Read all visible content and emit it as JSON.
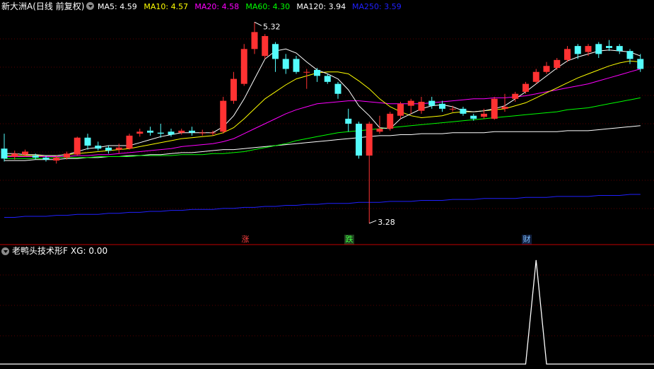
{
  "header": {
    "title": "新大洲A(日线 前复权)",
    "ma": [
      {
        "label": "MA5:",
        "value": "4.59",
        "color": "#ffffff"
      },
      {
        "label": "MA10:",
        "value": "4.57",
        "color": "#ffff00"
      },
      {
        "label": "MA20:",
        "value": "4.58",
        "color": "#ff00ff"
      },
      {
        "label": "MA60:",
        "value": "4.30",
        "color": "#00ff00"
      },
      {
        "label": "MA120:",
        "value": "3.94",
        "color": "#ffffff"
      },
      {
        "label": "MA250:",
        "value": "3.59",
        "color": "#2020ff"
      }
    ]
  },
  "markers": {
    "high": "5.32",
    "low": "3.28",
    "zhang": "涨",
    "die": "跌",
    "cai": "财"
  },
  "indicator": {
    "title": "老鸭头技术形F",
    "xg": "XG: 0.00"
  },
  "colors": {
    "up": "#ff3232",
    "down": "#54fcfc",
    "ma5": "#ffffff",
    "ma10": "#ffff00",
    "ma20": "#ff00ff",
    "ma60": "#00ff00",
    "ma120": "#ffffff",
    "ma250": "#2020ff"
  },
  "chart_data": {
    "type": "candlestick",
    "ylim": [
      3.2,
      5.4
    ],
    "candles": [
      {
        "o": 4.05,
        "c": 3.95,
        "h": 4.2,
        "l": 3.92
      },
      {
        "o": 3.97,
        "c": 4.0,
        "h": 4.03,
        "l": 3.94
      },
      {
        "o": 3.99,
        "c": 4.02,
        "h": 4.04,
        "l": 3.97
      },
      {
        "o": 3.98,
        "c": 3.96,
        "h": 4.0,
        "l": 3.94
      },
      {
        "o": 3.96,
        "c": 3.94,
        "h": 3.98,
        "l": 3.92
      },
      {
        "o": 3.93,
        "c": 3.96,
        "h": 3.98,
        "l": 3.9
      },
      {
        "o": 3.96,
        "c": 4.0,
        "h": 4.02,
        "l": 3.94
      },
      {
        "o": 3.99,
        "c": 4.16,
        "h": 4.17,
        "l": 3.98
      },
      {
        "o": 4.16,
        "c": 4.08,
        "h": 4.2,
        "l": 4.04
      },
      {
        "o": 4.08,
        "c": 4.05,
        "h": 4.12,
        "l": 4.03
      },
      {
        "o": 4.06,
        "c": 4.03,
        "h": 4.08,
        "l": 4.0
      },
      {
        "o": 4.04,
        "c": 4.06,
        "h": 4.1,
        "l": 4.0
      },
      {
        "o": 4.05,
        "c": 4.18,
        "h": 4.2,
        "l": 4.04
      },
      {
        "o": 4.2,
        "c": 4.22,
        "h": 4.25,
        "l": 4.17
      },
      {
        "o": 4.23,
        "c": 4.21,
        "h": 4.27,
        "l": 4.18
      },
      {
        "o": 4.21,
        "c": 4.2,
        "h": 4.3,
        "l": 4.16
      },
      {
        "o": 4.22,
        "c": 4.19,
        "h": 4.25,
        "l": 4.17
      },
      {
        "o": 4.21,
        "c": 4.23,
        "h": 4.25,
        "l": 4.19
      },
      {
        "o": 4.23,
        "c": 4.21,
        "h": 4.27,
        "l": 4.18
      },
      {
        "o": 4.21,
        "c": 4.21,
        "h": 4.24,
        "l": 4.18
      },
      {
        "o": 4.21,
        "c": 4.21,
        "h": 4.23,
        "l": 4.18
      },
      {
        "o": 4.22,
        "c": 4.53,
        "h": 4.57,
        "l": 4.2
      },
      {
        "o": 4.53,
        "c": 4.75,
        "h": 4.82,
        "l": 4.5
      },
      {
        "o": 4.7,
        "c": 5.05,
        "h": 5.1,
        "l": 4.68
      },
      {
        "o": 5.05,
        "c": 5.22,
        "h": 5.32,
        "l": 5.0
      },
      {
        "o": 4.98,
        "c": 5.18,
        "h": 5.2,
        "l": 4.95
      },
      {
        "o": 5.1,
        "c": 4.95,
        "h": 5.12,
        "l": 4.82
      },
      {
        "o": 4.95,
        "c": 4.85,
        "h": 5.0,
        "l": 4.8
      },
      {
        "o": 4.95,
        "c": 4.82,
        "h": 4.98,
        "l": 4.8
      },
      {
        "o": 4.82,
        "c": 4.82,
        "h": 4.85,
        "l": 4.65
      },
      {
        "o": 4.84,
        "c": 4.78,
        "h": 4.86,
        "l": 4.72
      },
      {
        "o": 4.78,
        "c": 4.72,
        "h": 4.8,
        "l": 4.7
      },
      {
        "o": 4.7,
        "c": 4.6,
        "h": 4.72,
        "l": 4.55
      },
      {
        "o": 4.35,
        "c": 4.3,
        "h": 4.45,
        "l": 4.22
      },
      {
        "o": 4.3,
        "c": 3.98,
        "h": 4.32,
        "l": 3.95
      },
      {
        "o": 3.98,
        "c": 4.3,
        "h": 4.32,
        "l": 3.3
      },
      {
        "o": 4.22,
        "c": 4.25,
        "h": 4.38,
        "l": 4.2
      },
      {
        "o": 4.25,
        "c": 4.4,
        "h": 4.42,
        "l": 4.23
      },
      {
        "o": 4.38,
        "c": 4.5,
        "h": 4.52,
        "l": 4.35
      },
      {
        "o": 4.48,
        "c": 4.53,
        "h": 4.55,
        "l": 4.4
      },
      {
        "o": 4.43,
        "c": 4.52,
        "h": 4.57,
        "l": 4.4
      },
      {
        "o": 4.53,
        "c": 4.48,
        "h": 4.57,
        "l": 4.45
      },
      {
        "o": 4.5,
        "c": 4.45,
        "h": 4.53,
        "l": 4.42
      },
      {
        "o": 4.45,
        "c": 4.45,
        "h": 4.48,
        "l": 4.42
      },
      {
        "o": 4.45,
        "c": 4.4,
        "h": 4.47,
        "l": 4.38
      },
      {
        "o": 4.38,
        "c": 4.35,
        "h": 4.4,
        "l": 4.33
      },
      {
        "o": 4.37,
        "c": 4.4,
        "h": 4.45,
        "l": 4.35
      },
      {
        "o": 4.35,
        "c": 4.55,
        "h": 4.57,
        "l": 4.34
      },
      {
        "o": 4.45,
        "c": 4.47,
        "h": 4.6,
        "l": 4.42
      },
      {
        "o": 4.55,
        "c": 4.6,
        "h": 4.62,
        "l": 4.52
      },
      {
        "o": 4.62,
        "c": 4.7,
        "h": 4.72,
        "l": 4.6
      },
      {
        "o": 4.72,
        "c": 4.82,
        "h": 4.85,
        "l": 4.7
      },
      {
        "o": 4.82,
        "c": 4.88,
        "h": 4.92,
        "l": 4.8
      },
      {
        "o": 4.86,
        "c": 4.94,
        "h": 4.96,
        "l": 4.84
      },
      {
        "o": 4.94,
        "c": 5.05,
        "h": 5.08,
        "l": 4.92
      },
      {
        "o": 5.08,
        "c": 5.0,
        "h": 5.1,
        "l": 4.95
      },
      {
        "o": 5.02,
        "c": 5.08,
        "h": 5.1,
        "l": 4.98
      },
      {
        "o": 5.1,
        "c": 5.0,
        "h": 5.12,
        "l": 4.96
      },
      {
        "o": 5.08,
        "c": 5.06,
        "h": 5.14,
        "l": 5.03
      },
      {
        "o": 5.08,
        "c": 5.03,
        "h": 5.1,
        "l": 5.0
      },
      {
        "o": 5.03,
        "c": 4.95,
        "h": 5.05,
        "l": 4.9
      },
      {
        "o": 4.95,
        "c": 4.85,
        "h": 5.0,
        "l": 4.82
      }
    ],
    "ma5": [
      4.0,
      4.0,
      3.99,
      3.99,
      3.98,
      3.98,
      3.99,
      4.02,
      4.05,
      4.06,
      4.08,
      4.08,
      4.08,
      4.11,
      4.14,
      4.17,
      4.19,
      4.21,
      4.21,
      4.21,
      4.21,
      4.27,
      4.38,
      4.55,
      4.75,
      4.95,
      5.03,
      5.05,
      5.01,
      4.92,
      4.84,
      4.8,
      4.75,
      4.64,
      4.48,
      4.38,
      4.26,
      4.25,
      4.35,
      4.4,
      4.45,
      4.48,
      4.49,
      4.47,
      4.43,
      4.42,
      4.43,
      4.45,
      4.48,
      4.55,
      4.62,
      4.7,
      4.78,
      4.86,
      4.93,
      4.97,
      5.0,
      5.03,
      5.04,
      5.03,
      5.02,
      4.98
    ],
    "ma10": [
      3.98,
      3.98,
      3.98,
      3.98,
      3.98,
      3.98,
      3.99,
      4.0,
      4.01,
      4.02,
      4.03,
      4.04,
      4.05,
      4.07,
      4.09,
      4.11,
      4.13,
      4.15,
      4.16,
      4.17,
      4.18,
      4.21,
      4.26,
      4.35,
      4.45,
      4.55,
      4.62,
      4.69,
      4.75,
      4.78,
      4.81,
      4.82,
      4.82,
      4.8,
      4.73,
      4.65,
      4.55,
      4.47,
      4.42,
      4.38,
      4.36,
      4.37,
      4.38,
      4.41,
      4.42,
      4.42,
      4.43,
      4.44,
      4.45,
      4.48,
      4.51,
      4.56,
      4.61,
      4.66,
      4.71,
      4.76,
      4.8,
      4.84,
      4.88,
      4.91,
      4.93,
      4.92
    ],
    "ma20": [
      3.97,
      3.97,
      3.97,
      3.97,
      3.97,
      3.97,
      3.97,
      3.98,
      3.98,
      3.99,
      3.99,
      4.0,
      4.01,
      4.02,
      4.03,
      4.04,
      4.05,
      4.07,
      4.08,
      4.09,
      4.1,
      4.12,
      4.15,
      4.2,
      4.25,
      4.3,
      4.35,
      4.4,
      4.44,
      4.47,
      4.5,
      4.51,
      4.52,
      4.53,
      4.53,
      4.52,
      4.51,
      4.5,
      4.5,
      4.5,
      4.5,
      4.51,
      4.52,
      4.53,
      4.54,
      4.55,
      4.55,
      4.56,
      4.56,
      4.57,
      4.58,
      4.6,
      4.62,
      4.64,
      4.66,
      4.68,
      4.7,
      4.73,
      4.76,
      4.79,
      4.82,
      4.85
    ],
    "ma60": [
      3.95,
      3.95,
      3.95,
      3.95,
      3.95,
      3.96,
      3.96,
      3.96,
      3.96,
      3.97,
      3.97,
      3.97,
      3.97,
      3.98,
      3.98,
      3.98,
      3.98,
      3.99,
      3.99,
      3.99,
      4.0,
      4.0,
      4.01,
      4.02,
      4.04,
      4.06,
      4.08,
      4.1,
      4.13,
      4.15,
      4.17,
      4.19,
      4.21,
      4.22,
      4.23,
      4.24,
      4.25,
      4.26,
      4.27,
      4.28,
      4.29,
      4.3,
      4.31,
      4.32,
      4.33,
      4.34,
      4.35,
      4.36,
      4.37,
      4.38,
      4.39,
      4.4,
      4.41,
      4.42,
      4.44,
      4.45,
      4.46,
      4.48,
      4.5,
      4.52,
      4.54,
      4.56
    ],
    "ma120": [
      3.93,
      3.93,
      3.93,
      3.94,
      3.94,
      3.94,
      3.95,
      3.95,
      3.96,
      3.96,
      3.97,
      3.97,
      3.98,
      3.98,
      3.99,
      3.99,
      4.0,
      4.01,
      4.01,
      4.02,
      4.03,
      4.04,
      4.04,
      4.05,
      4.06,
      4.07,
      4.08,
      4.09,
      4.1,
      4.11,
      4.12,
      4.13,
      4.14,
      4.15,
      4.16,
      4.17,
      4.18,
      4.18,
      4.19,
      4.19,
      4.2,
      4.2,
      4.2,
      4.21,
      4.21,
      4.21,
      4.21,
      4.22,
      4.22,
      4.22,
      4.22,
      4.22,
      4.22,
      4.22,
      4.23,
      4.23,
      4.23,
      4.24,
      4.25,
      4.26,
      4.27,
      4.28
    ],
    "ma250": [
      3.36,
      3.36,
      3.37,
      3.37,
      3.37,
      3.38,
      3.38,
      3.39,
      3.39,
      3.39,
      3.4,
      3.4,
      3.41,
      3.41,
      3.42,
      3.42,
      3.43,
      3.43,
      3.44,
      3.44,
      3.44,
      3.45,
      3.45,
      3.46,
      3.46,
      3.47,
      3.47,
      3.48,
      3.48,
      3.49,
      3.49,
      3.5,
      3.5,
      3.5,
      3.51,
      3.51,
      3.51,
      3.52,
      3.52,
      3.52,
      3.53,
      3.53,
      3.53,
      3.54,
      3.54,
      3.54,
      3.55,
      3.55,
      3.55,
      3.55,
      3.56,
      3.56,
      3.56,
      3.57,
      3.57,
      3.57,
      3.57,
      3.58,
      3.58,
      3.58,
      3.59,
      3.59
    ],
    "xg": [
      0,
      0,
      0,
      0,
      0,
      0,
      0,
      0,
      0,
      0,
      0,
      0,
      0,
      0,
      0,
      0,
      0,
      0,
      0,
      0,
      0,
      0,
      0,
      0,
      0,
      0,
      0,
      0,
      0,
      0,
      0,
      0,
      0,
      0,
      0,
      0,
      0,
      0,
      0,
      0,
      0,
      0,
      0,
      0,
      0,
      0,
      0,
      0,
      0,
      0,
      0,
      1,
      0,
      0,
      0,
      0,
      0,
      0,
      0,
      0,
      0,
      0
    ]
  }
}
